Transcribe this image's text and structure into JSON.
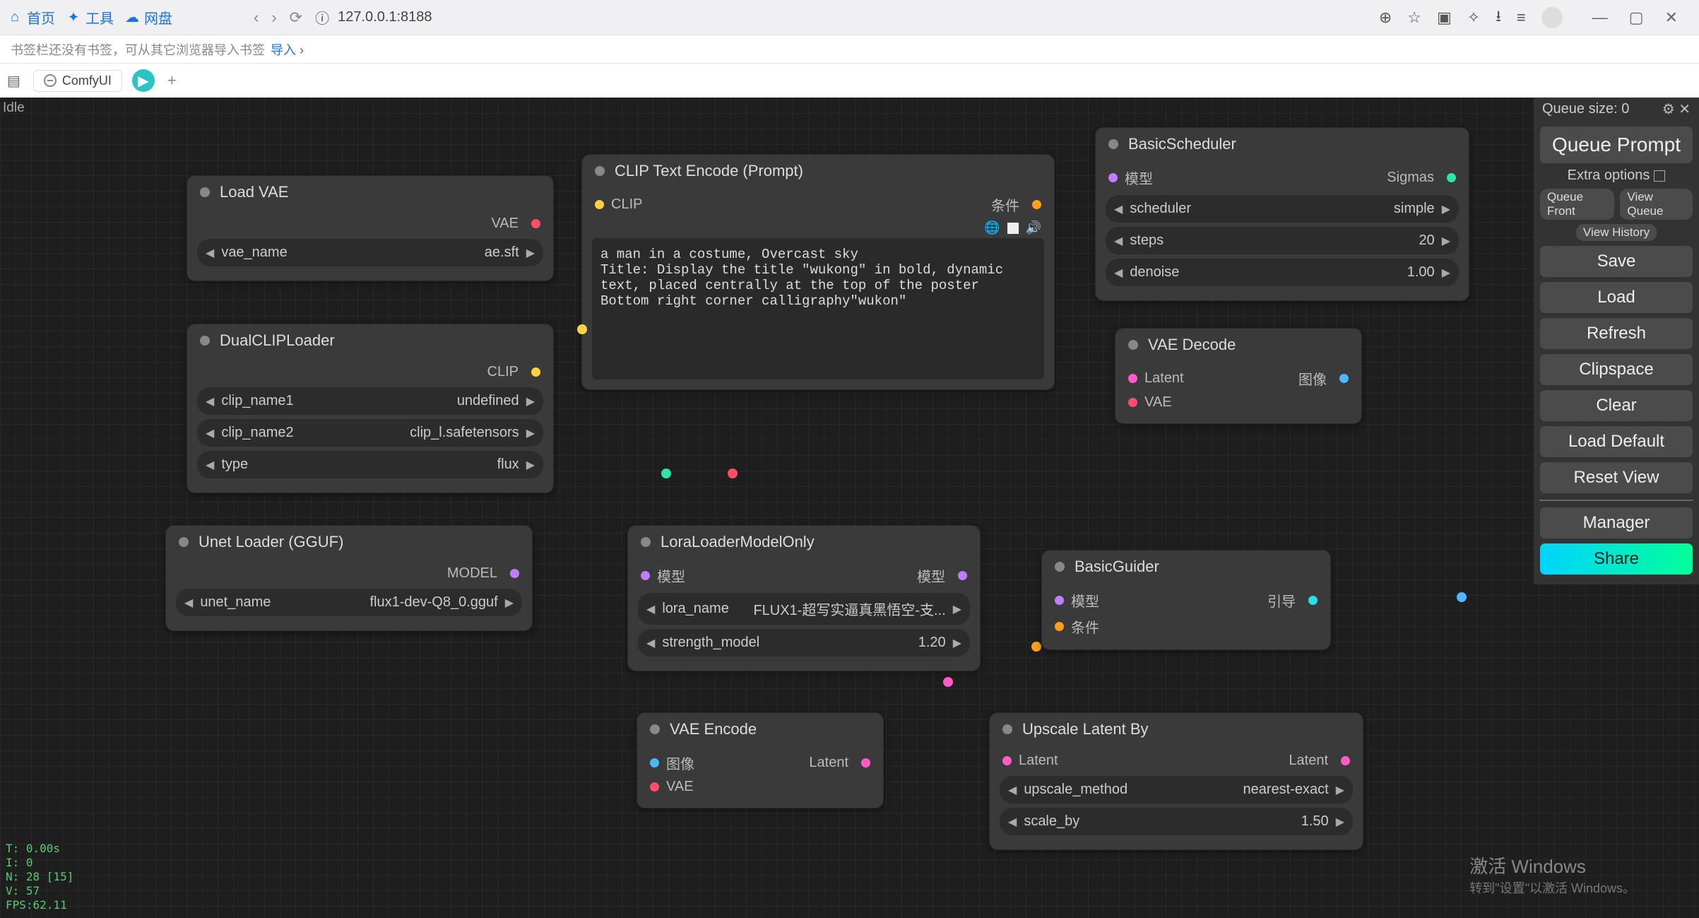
{
  "browser": {
    "top_links": {
      "home": "首页",
      "tools": "工具",
      "cloud": "网盘"
    },
    "url": "127.0.0.1:8188",
    "bookmark_hint": "书签栏还没有书签，可从其它浏览器导入书签",
    "import": "导入",
    "tab_title": "ComfyUI"
  },
  "status": "Idle",
  "panel": {
    "queue_size_label": "Queue size: 0",
    "queue_prompt": "Queue Prompt",
    "extra_options": "Extra options",
    "queue_front": "Queue Front",
    "view_queue": "View Queue",
    "view_history": "View History",
    "save": "Save",
    "load": "Load",
    "refresh": "Refresh",
    "clipspace": "Clipspace",
    "clear": "Clear",
    "load_default": "Load Default",
    "reset_view": "Reset View",
    "manager": "Manager",
    "share": "Share"
  },
  "nodes": {
    "load_vae": {
      "title": "Load VAE",
      "out": "VAE",
      "widget": {
        "label": "vae_name",
        "value": "ae.sft"
      }
    },
    "dual_clip": {
      "title": "DualCLIPLoader",
      "out": "CLIP",
      "w1": {
        "label": "clip_name1",
        "value": "undefined"
      },
      "w2": {
        "label": "clip_name2",
        "value": "clip_l.safetensors"
      },
      "w3": {
        "label": "type",
        "value": "flux"
      }
    },
    "unet": {
      "title": "Unet Loader (GGUF)",
      "out": "MODEL",
      "w": {
        "label": "unet_name",
        "value": "flux1-dev-Q8_0.gguf"
      }
    },
    "clip_encode": {
      "title": "CLIP Text Encode (Prompt)",
      "in": "CLIP",
      "out": "条件",
      "text": "a man in a costume, Overcast sky\nTitle: Display the title \"wukong\" in bold, dynamic text, placed centrally at the top of the poster\nBottom right corner calligraphy\"wukon\""
    },
    "scheduler": {
      "title": "BasicScheduler",
      "in": "模型",
      "out": "Sigmas",
      "w1": {
        "label": "scheduler",
        "value": "simple"
      },
      "w2": {
        "label": "steps",
        "value": "20"
      },
      "w3": {
        "label": "denoise",
        "value": "1.00"
      }
    },
    "vae_decode": {
      "title": "VAE Decode",
      "in1": "Latent",
      "in2": "VAE",
      "out": "图像"
    },
    "lora": {
      "title": "LoraLoaderModelOnly",
      "in": "模型",
      "out": "模型",
      "w1": {
        "label": "lora_name",
        "value": "FLUX1-超写实逼真黑悟空-支..."
      },
      "w2": {
        "label": "strength_model",
        "value": "1.20"
      }
    },
    "guider": {
      "title": "BasicGuider",
      "in1": "模型",
      "in2": "条件",
      "out": "引导"
    },
    "vae_encode": {
      "title": "VAE Encode",
      "in1": "图像",
      "in2": "VAE",
      "out": "Latent"
    },
    "upscale": {
      "title": "Upscale Latent By",
      "in": "Latent",
      "out": "Latent",
      "w1": {
        "label": "upscale_method",
        "value": "nearest-exact"
      },
      "w2": {
        "label": "scale_by",
        "value": "1.50"
      }
    }
  },
  "stats": {
    "t": "T: 0.00s",
    "i": "I: 0",
    "n": "N: 28 [15]",
    "v": "V: 57",
    "fps": "FPS:62.11"
  },
  "watermark": {
    "title": "激活 Windows",
    "sub": "转到\"设置\"以激活 Windows。"
  },
  "colors": {
    "vae_red": "#ff4d6a",
    "clip_yellow": "#ffd23f",
    "model_purple": "#c07dff",
    "latent_pink": "#ff5cc8",
    "cond_orange": "#ff9f1c",
    "sigmas_teal": "#2ee6a8",
    "image_blue": "#4db8ff",
    "guide_cyan": "#2be0e0"
  }
}
